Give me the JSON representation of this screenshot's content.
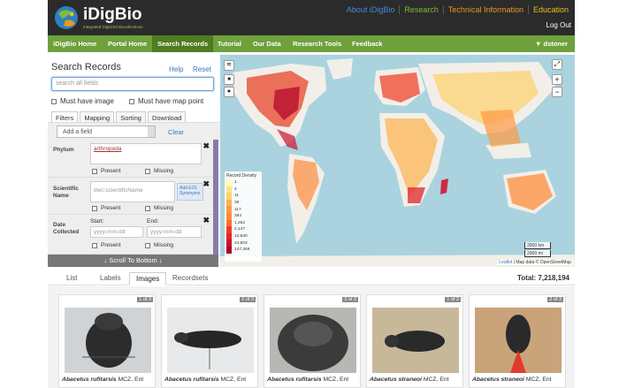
{
  "header": {
    "logo_text": "iDigBio",
    "logo_tagline": "Integrated Digitized Biocollections",
    "topnav": [
      {
        "label": "About iDigBio",
        "color": "#3f8fd8"
      },
      {
        "label": "Research",
        "color": "#7bbd3a"
      },
      {
        "label": "Technical Information",
        "color": "#e59a22"
      },
      {
        "label": "Education",
        "color": "#e5c020"
      }
    ],
    "logout": "Log Out"
  },
  "nav": {
    "items": [
      "iDigBio Home",
      "Portal Home",
      "Search Records",
      "Tutorial",
      "Our Data",
      "Research Tools",
      "Feedback"
    ],
    "active": "Search Records",
    "user": "▼ dstoner"
  },
  "search": {
    "title": "Search Records",
    "help": "Help",
    "reset": "Reset",
    "placeholder": "search all fields",
    "must_have_image": "Must have image",
    "must_have_map": "Must have map point",
    "tabs": [
      "Filters",
      "Mapping",
      "Sorting",
      "Download"
    ],
    "add_field": "Add a field",
    "clear": "Clear",
    "fields": {
      "phylum_label": "Phylum",
      "phylum_value": "arthropoda",
      "sci_label_1": "Scientific",
      "sci_label_2": "Name",
      "sci_placeholder": "dwc:scientificName",
      "sci_add_1": "Add",
      "sci_add_2": "EOL",
      "sci_add_3": "Synonyms",
      "date_label_1": "Date",
      "date_label_2": "Collected",
      "start": "Start:",
      "end": "End:",
      "date_placeholder": "yyyy-mm-dd",
      "present": "Present",
      "missing": "Missing",
      "remove": "✖"
    },
    "scroll_bottom": "↓ Scroll To Bottom ↓"
  },
  "map": {
    "legend_title": "Record Density",
    "legend": [
      {
        "v": "1",
        "c": "#ffffb2"
      },
      {
        "v": "4",
        "c": "#fee38a"
      },
      {
        "v": "11",
        "c": "#fed06a"
      },
      {
        "v": "36",
        "c": "#feb24c"
      },
      {
        "v": "117",
        "c": "#fd9a42"
      },
      {
        "v": "384",
        "c": "#fd8d3c"
      },
      {
        "v": "1,262",
        "c": "#fc6c33"
      },
      {
        "v": "4,147",
        "c": "#f03b20"
      },
      {
        "v": "13,630",
        "c": "#e0252a"
      },
      {
        "v": "44,803",
        "c": "#c81430"
      },
      {
        "v": "147,269",
        "c": "#b10026"
      }
    ],
    "scale_km": "3000 km",
    "scale_mi": "2000 mi",
    "attribution_link": "Leaflet",
    "attribution_text": " | Map data © OpenStreetMap",
    "zoom_in": "+",
    "zoom_out": "−",
    "land_color": "#f2efe9",
    "water_color": "#aad3df"
  },
  "results": {
    "tabs": [
      "List",
      "Labels",
      "Images",
      "Recordsets"
    ],
    "active_tab": "Images",
    "total": "Total: 7,218,194",
    "cards": [
      {
        "badge": "1 of 3",
        "name": "Abacetus rufitarsis",
        "suffix": " MCZ, Ent"
      },
      {
        "badge": "2 of 3",
        "name": "Abacetus rufitarsis",
        "suffix": " MCZ, Ent"
      },
      {
        "badge": "3 of 3",
        "name": "Abacetus rufitarsis",
        "suffix": " MCZ, Ent"
      },
      {
        "badge": "1 of 3",
        "name": "Abacetus straneoi",
        "suffix": " MCZ, Ent"
      },
      {
        "badge": "2 of 3",
        "name": "Abacetus straneoi",
        "suffix": " MCZ, Ent"
      }
    ]
  }
}
